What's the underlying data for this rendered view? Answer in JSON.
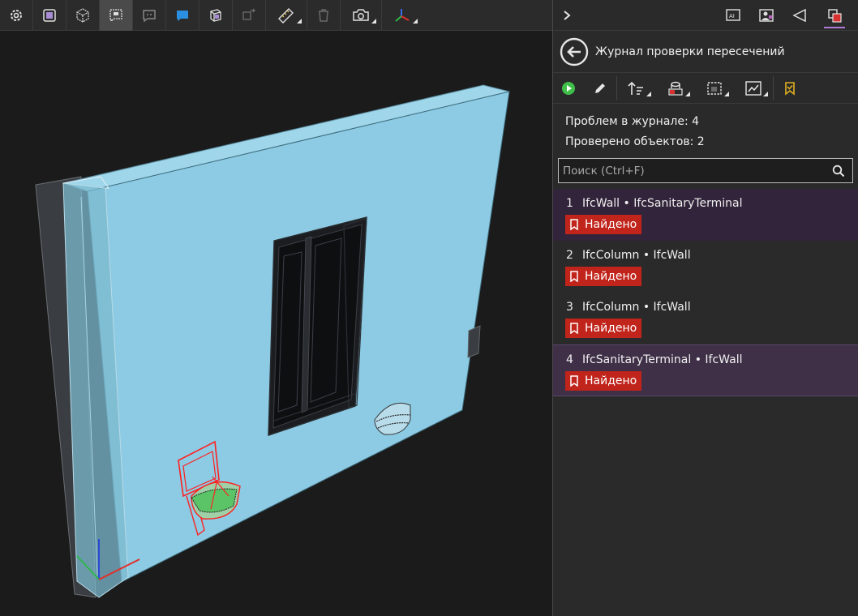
{
  "journal": {
    "title": "Журнал проверки пересечений",
    "problems_label": "Проблем в журнале: 4",
    "checked_label": "Проверено объектов: 2"
  },
  "search": {
    "placeholder": "Поиск (Ctrl+F)"
  },
  "issues": [
    {
      "num": "1",
      "title": "IfcWall • IfcSanitaryTerminal",
      "status": "Найдено"
    },
    {
      "num": "2",
      "title": "IfcColumn • IfcWall",
      "status": "Найдено"
    },
    {
      "num": "3",
      "title": "IfcColumn • IfcWall",
      "status": "Найдено"
    },
    {
      "num": "4",
      "title": "IfcSanitaryTerminal • IfcWall",
      "status": "Найдено"
    }
  ],
  "colors": {
    "accent": "#b07ad6",
    "badge": "#c0241b",
    "wall": "#8ccbe3",
    "clash": "#ff2020"
  },
  "icons": {
    "toolbar": [
      "gear-icon",
      "frame-icon",
      "cube-icon",
      "comment-frame-icon",
      "comment-icon",
      "comment-filled-icon",
      "section-box-icon",
      "move-icon",
      "ruler-icon",
      "trash-icon",
      "camera-icon",
      "axes-icon"
    ],
    "panel_top": [
      "chevron-right-icon",
      "ai-icon",
      "image-user-icon",
      "cursor-icon",
      "clash-icon"
    ],
    "journal_toolbar": [
      "play-icon",
      "pencil-icon",
      "sort-icon",
      "highlight-icon",
      "select-box-icon",
      "chart-icon",
      "checklist-icon"
    ]
  }
}
